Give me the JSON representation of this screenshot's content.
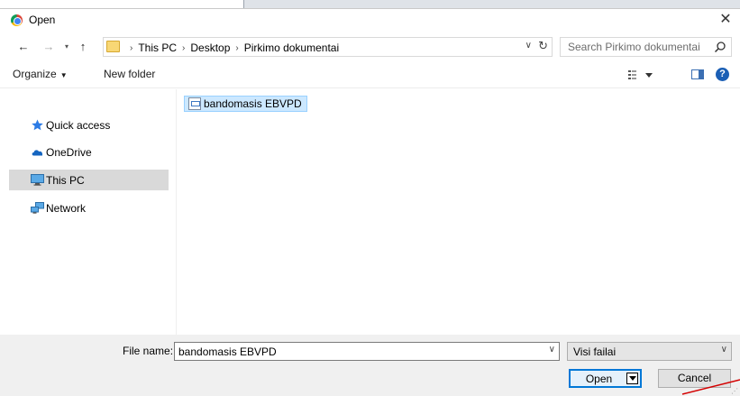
{
  "window": {
    "title": "Open",
    "close_glyph": "✕",
    "icon": "chrome-icon"
  },
  "navigation": {
    "back_glyph": "←",
    "forward_glyph": "→",
    "recent_glyph": "▾",
    "up_glyph": "↑"
  },
  "address": {
    "crumbs": [
      "This PC",
      "Desktop",
      "Pirkimo dokumentai"
    ],
    "separator": "›",
    "dropdown_glyph": "∨",
    "refresh_glyph": "↻"
  },
  "search": {
    "placeholder": "Search Pirkimo dokumentai"
  },
  "toolbar": {
    "organize_label": "Organize",
    "organize_caret": "▼",
    "new_folder_label": "New folder",
    "help_glyph": "?"
  },
  "sidebar": {
    "items": [
      {
        "label": "Quick access",
        "icon": "star-icon",
        "selected": false
      },
      {
        "label": "OneDrive",
        "icon": "cloud-icon",
        "selected": false
      },
      {
        "label": "This PC",
        "icon": "monitor-icon",
        "selected": true
      },
      {
        "label": "Network",
        "icon": "network-icon",
        "selected": false
      }
    ]
  },
  "files": [
    {
      "name": "bandomasis EBVPD",
      "selected": true
    }
  ],
  "footer": {
    "file_name_label": "File name:",
    "file_name_value": "bandomasis EBVPD",
    "file_type_value": "Visi failai",
    "open_label": "Open",
    "cancel_label": "Cancel",
    "dropdown_glyph": "∨",
    "grip_glyph": "⋰"
  },
  "colors": {
    "selection_fill": "#cce8ff",
    "selection_border": "#99d1ff",
    "sidebar_selected": "#d9d9d9",
    "accent": "#0078d7",
    "annotation_stroke": "#d40000"
  }
}
